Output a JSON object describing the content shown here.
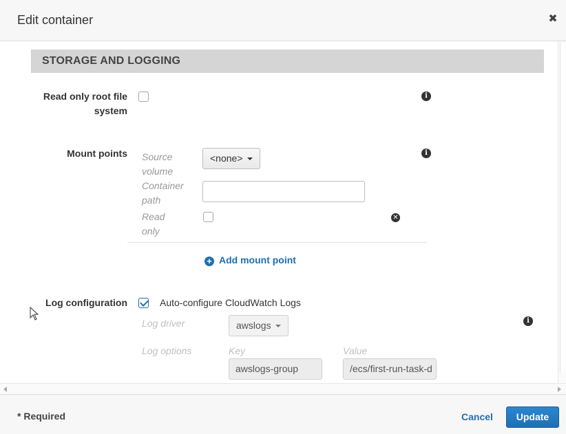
{
  "dialog": {
    "title": "Edit container",
    "close_icon": "close-icon"
  },
  "section": {
    "title": "STORAGE AND LOGGING"
  },
  "read_only_root": {
    "label_line1": "Read only root file",
    "label_line2": "system",
    "checked": false
  },
  "mount_points": {
    "label": "Mount points",
    "source_volume_label_1": "Source",
    "source_volume_label_2": "volume",
    "source_volume_value": "<none>",
    "container_path_label_1": "Container",
    "container_path_label_2": "path",
    "container_path_value": "",
    "read_only_label_1": "Read",
    "read_only_label_2": "only",
    "read_only_checked": false,
    "add_label": "Add mount point"
  },
  "log_configuration": {
    "label": "Log configuration",
    "auto_configure_label": "Auto-configure CloudWatch Logs",
    "auto_configure_checked": true,
    "log_driver_label": "Log driver",
    "log_driver_value": "awslogs",
    "log_options_label": "Log options",
    "key_label": "Key",
    "value_label": "Value",
    "key_value": "awslogs-group",
    "value_value": "/ecs/first-run-task-d"
  },
  "footer": {
    "required_text": "* Required",
    "cancel_label": "Cancel",
    "update_label": "Update"
  },
  "colors": {
    "accent": "#1f6fb2",
    "section_header_bg": "#d5d5d5"
  }
}
